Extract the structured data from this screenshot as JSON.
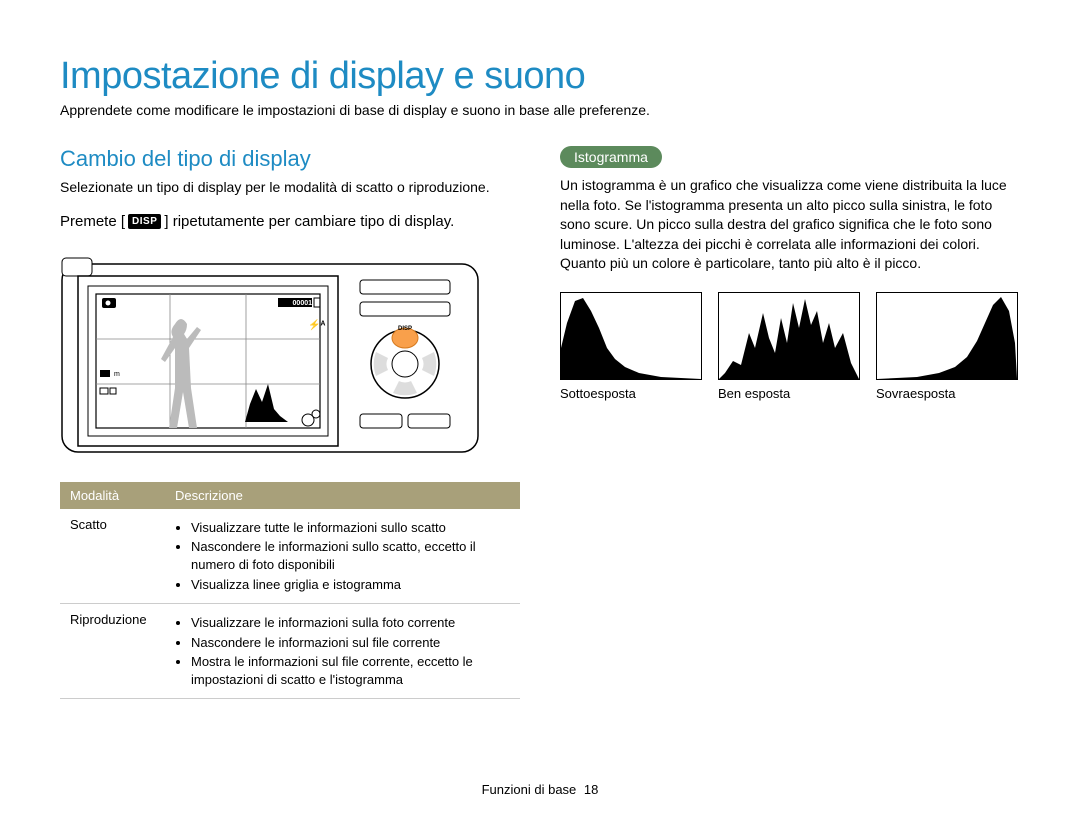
{
  "header": {
    "title": "Impostazione di display e suono",
    "subtitle": "Apprendete come modificare le impostazioni di base di display e suono in base alle preferenze."
  },
  "left": {
    "section_title": "Cambio del tipo di display",
    "intro": "Selezionate un tipo di display per le modalità di scatto o riproduzione.",
    "instr_pre": "Premete [",
    "instr_icon": "DISP",
    "instr_post": "] ripetutamente per cambiare tipo di display.",
    "camera_screen": {
      "counter": "00001"
    }
  },
  "table": {
    "head": {
      "col1": "Modalità",
      "col2": "Descrizione"
    },
    "rows": [
      {
        "mode": "Scatto",
        "bullets": [
          "Visualizzare tutte le informazioni sullo scatto",
          "Nascondere le informazioni sullo scatto, eccetto il numero di foto disponibili",
          "Visualizza linee griglia e istogramma"
        ]
      },
      {
        "mode": "Riproduzione",
        "bullets": [
          "Visualizzare le informazioni sulla foto corrente",
          "Nascondere le informazioni sul file corrente",
          "Mostra le informazioni sul file corrente, eccetto le impostazioni di scatto e l'istogramma"
        ]
      }
    ]
  },
  "right": {
    "pill": "Istogramma",
    "paragraph": "Un istogramma è un grafico che visualizza come viene distribuita la luce nella foto. Se l'istogramma presenta un alto picco sulla sinistra, le foto sono scure. Un picco sulla destra del grafico significa che le foto sono luminose. L'altezza dei picchi è correlata alle informazioni dei colori. Quanto più un colore è particolare, tanto più alto è il picco.",
    "histograms": [
      {
        "label": "Sottoesposta"
      },
      {
        "label": "Ben esposta"
      },
      {
        "label": "Sovraesposta"
      }
    ]
  },
  "footer": {
    "section": "Funzioni di base",
    "page": "18"
  }
}
